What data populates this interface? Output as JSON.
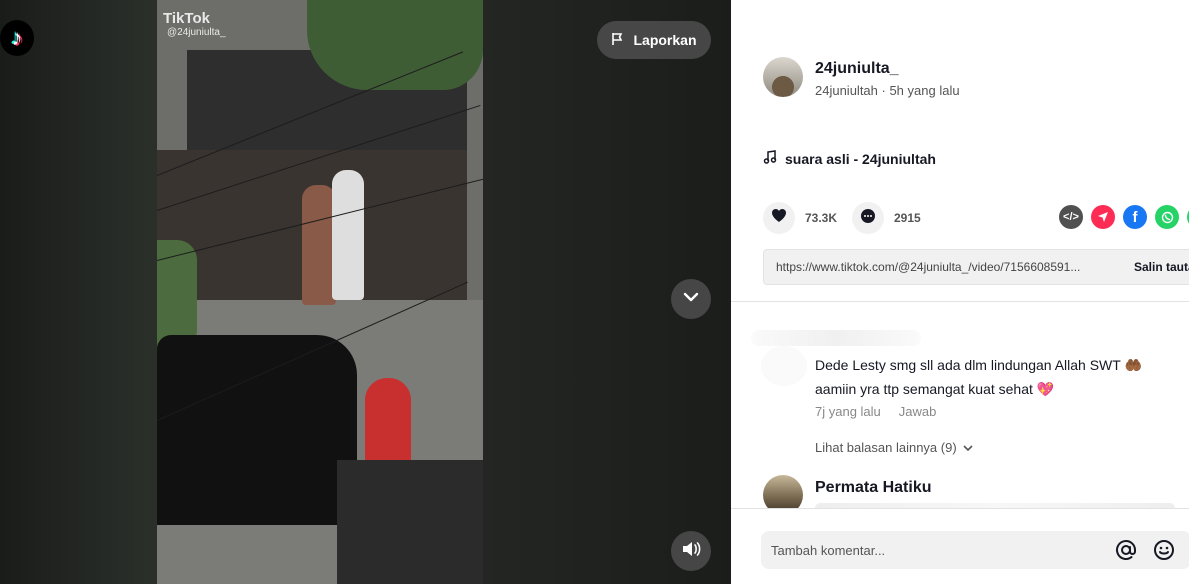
{
  "video": {
    "watermark_title": "TikTok",
    "watermark_user": "@24juniulta_",
    "report_label": "Laporkan"
  },
  "author": {
    "display_name": "24juniulta_",
    "username": "24juniultah",
    "time": "5h yang lalu",
    "separator": " · "
  },
  "music": {
    "label": "suara asli - 24juniultah"
  },
  "stats": {
    "likes": "73.3K",
    "comments": "2915"
  },
  "share": {
    "url": "https://www.tiktok.com/@24juniulta_/video/7156608591...",
    "copy_label": "Salin tautan",
    "icons": [
      "embed-icon",
      "send-icon",
      "facebook-icon",
      "whatsapp-icon"
    ],
    "colors": {
      "send": "#fe2c55",
      "facebook": "#1877f2",
      "whatsapp": "#25d366",
      "embed": "#505050"
    }
  },
  "comments": [
    {
      "text": "Dede Lesty smg sll ada dlm lindungan Allah SWT 🤲🏾 aamiin yra ttp semangat kuat sehat 💖",
      "time": "7j yang lalu",
      "reply_label": "Jawab",
      "more_replies": "Lihat balasan lainnya (9)"
    },
    {
      "name": "Permata Hatiku"
    }
  ],
  "input": {
    "placeholder": "Tambah komentar..."
  }
}
